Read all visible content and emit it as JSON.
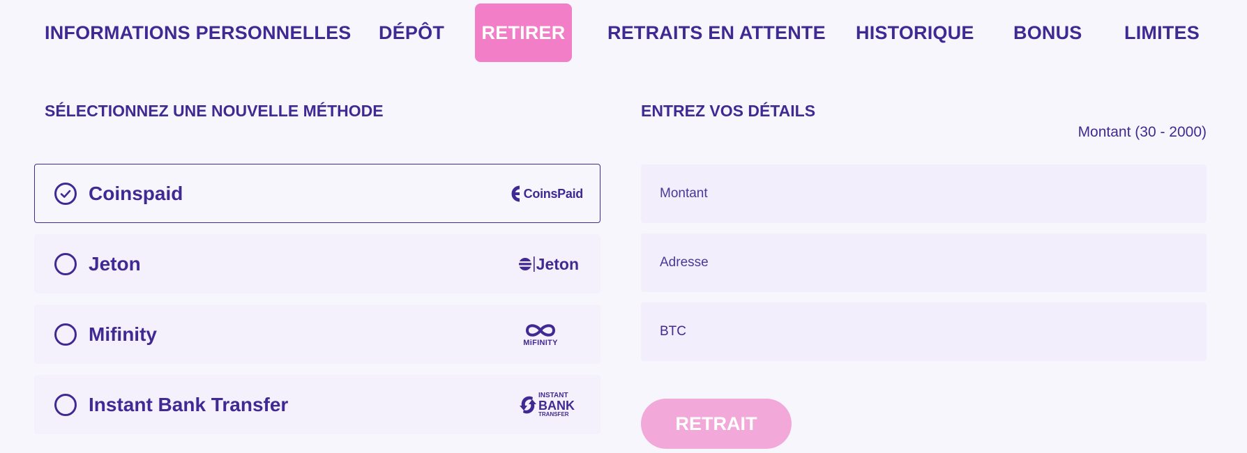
{
  "tabs": [
    {
      "label": "INFORMATIONS PERSONNELLES",
      "active": false
    },
    {
      "label": "DÉPÔT",
      "active": false
    },
    {
      "label": "RETIRER",
      "active": true
    },
    {
      "label": "RETRAITS EN ATTENTE",
      "active": false
    },
    {
      "label": "HISTORIQUE",
      "active": false
    },
    {
      "label": "BONUS",
      "active": false
    },
    {
      "label": "LIMITES",
      "active": false
    }
  ],
  "methods_section": {
    "title": "SÉLECTIONNEZ UNE NOUVELLE MÉTHODE",
    "items": [
      {
        "label": "Coinspaid",
        "selected": true,
        "logo_text": "CoinsPaid",
        "icon": "coinspaid-logo"
      },
      {
        "label": "Jeton",
        "selected": false,
        "logo_text": "Jeton",
        "icon": "jeton-logo"
      },
      {
        "label": "Mifinity",
        "selected": false,
        "logo_text": "MiFINITY",
        "icon": "mifinity-logo"
      },
      {
        "label": "Instant Bank Transfer",
        "selected": false,
        "logo_text_top": "INSTANT",
        "logo_text_mid": "BANK",
        "logo_text_bottom": "TRANSFER",
        "icon": "instant-bank-transfer-logo"
      }
    ]
  },
  "details_section": {
    "title": "ENTREZ VOS DÉTAILS",
    "amount_hint": "Montant (30 - 2000)",
    "fields": {
      "amount_placeholder": "Montant",
      "address_placeholder": "Adresse",
      "currency_value": "BTC"
    },
    "submit_label": "RETRAIT"
  },
  "colors": {
    "primary": "#3f2a93",
    "accent": "#f17ec6",
    "button_disabled": "#f2a8d8",
    "background": "#f8f6fd"
  }
}
